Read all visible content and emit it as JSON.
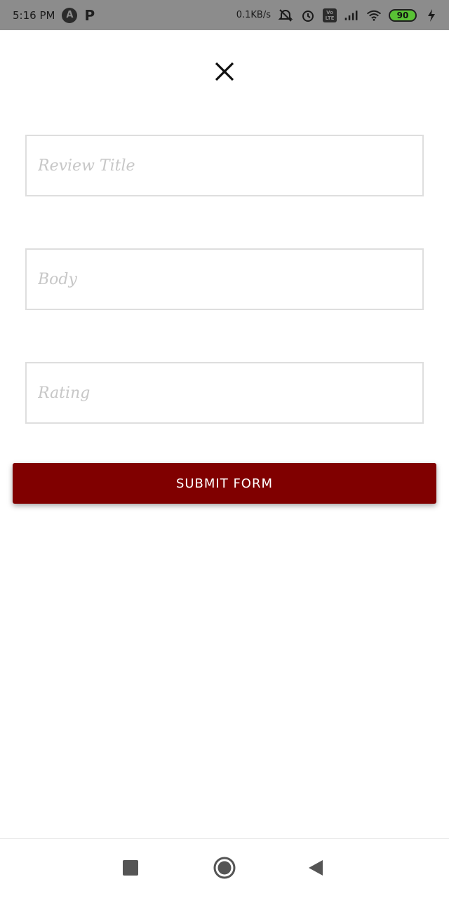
{
  "status_bar": {
    "time": "5:16 PM",
    "app_icon_letter": "A",
    "p_icon_letter": "P",
    "net_speed": "0.1KB/s",
    "volte_top": "Vo",
    "volte_bottom": "LTE",
    "battery": "90",
    "icons": [
      "alarm-off-icon",
      "alarm-icon",
      "signal-icon",
      "wifi-icon",
      "charging-icon"
    ]
  },
  "form": {
    "title_placeholder": "Review Title",
    "body_placeholder": "Body",
    "rating_placeholder": "Rating",
    "submit_label": "SUBMIT FORM"
  },
  "colors": {
    "accent": "#800000",
    "status_bar": "#8c8c8c",
    "input_border": "#dedede",
    "battery_fill": "#59c135"
  },
  "nav_bar": {
    "icons": [
      "recent-apps-icon",
      "home-icon",
      "back-icon"
    ]
  }
}
